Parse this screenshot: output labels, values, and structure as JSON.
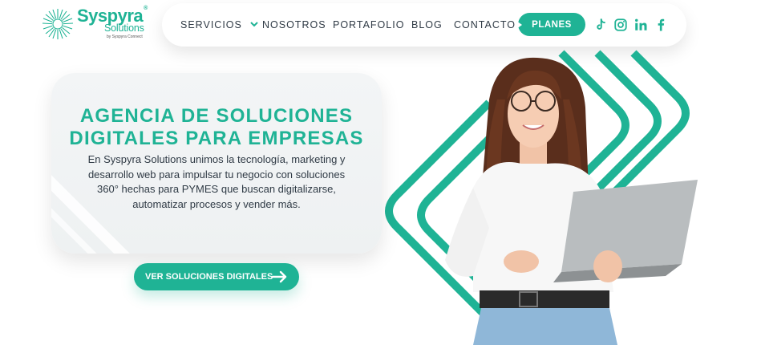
{
  "brand": {
    "name": "Syspyra",
    "reg": "®",
    "sub": "Solutions",
    "tagline": "by Syspyra Connect",
    "accent": "#1fb395",
    "text": "#2f3a45"
  },
  "nav": {
    "items": [
      {
        "label": "SERVICIOS",
        "has_dropdown": true
      },
      {
        "label": "NOSOTROS"
      },
      {
        "label": "PORTAFOLIO"
      },
      {
        "label": "BLOG"
      },
      {
        "label": "CONTACTO"
      }
    ],
    "cta_label": "PLANES",
    "social": [
      "tiktok-icon",
      "instagram-icon",
      "linkedin-icon",
      "facebook-icon"
    ]
  },
  "hero": {
    "title_line1": "AGENCIA DE SOLUCIONES",
    "title_line2": "DIGITALES PARA EMPRESAS",
    "description": "En Syspyra Solutions unimos la tecnología, marketing y desarrollo web para impulsar tu negocio con soluciones 360° hechas para PYMES que buscan digitalizarse, automatizar procesos y vender más.",
    "cta_label": "VER SOLUCIONES DIGITALES"
  }
}
